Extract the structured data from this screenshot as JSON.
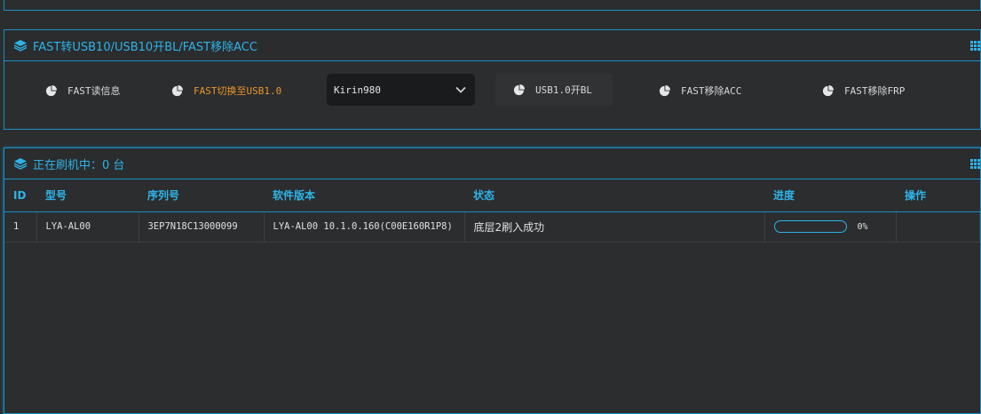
{
  "colors": {
    "accent": "#2fb4e8",
    "active": "#e8962c",
    "background": "#2b2d2f",
    "border": "#1b8fc0"
  },
  "fast_panel": {
    "title": "FAST转USB10/USB10开BL/FAST移除ACC",
    "buttons": [
      {
        "label": "FAST读信息",
        "icon": "pie-chart-icon"
      },
      {
        "label": "FAST切换至USB1.0",
        "icon": "pie-chart-icon",
        "active": true
      },
      {
        "label": "USB1.0开BL",
        "icon": "pie-chart-icon"
      },
      {
        "label": "FAST移除ACC",
        "icon": "pie-chart-icon"
      },
      {
        "label": "FAST移除FRP",
        "icon": "pie-chart-icon"
      }
    ],
    "chip_select": {
      "value": "Kirin980",
      "icon": "chevron-down-icon"
    }
  },
  "flash_panel": {
    "title": "正在刷机中：0 台",
    "columns": [
      "ID",
      "型号",
      "序列号",
      "软件版本",
      "状态",
      "进度",
      "操作"
    ],
    "rows": [
      {
        "id": "1",
        "model": "LYA-AL00",
        "serial": "3EP7N18C13000099",
        "version": "LYA-AL00 10.1.0.160(C00E160R1P8)",
        "status": "底层2刷入成功",
        "progress": 0,
        "progress_text": "0%",
        "action": ""
      }
    ]
  }
}
